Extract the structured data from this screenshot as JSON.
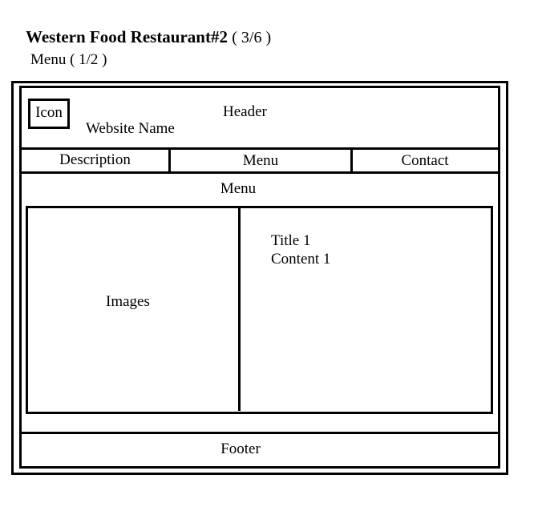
{
  "page": {
    "title": "Western Food Restaurant#2",
    "title_suffix": "( 3/6 )",
    "subtitle": "Menu ( 1/2 )"
  },
  "header": {
    "icon_label": "Icon",
    "site_name": "Website Name",
    "label": "Header"
  },
  "nav": {
    "items": [
      {
        "label": "Description"
      },
      {
        "label": "Menu"
      },
      {
        "label": "Contact"
      }
    ]
  },
  "main": {
    "section_title": "Menu",
    "images_label": "Images",
    "title_label": "Title 1",
    "content_label": "Content 1"
  },
  "footer": {
    "label": "Footer"
  }
}
